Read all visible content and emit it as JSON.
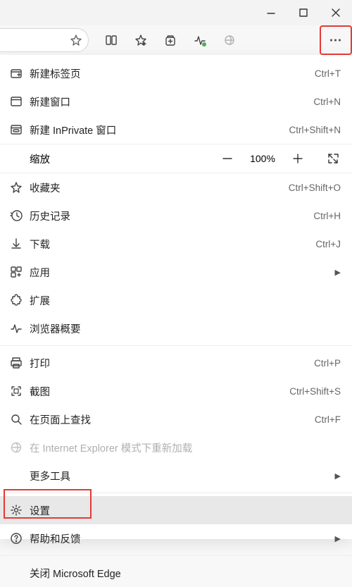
{
  "titlebar": {
    "minimize": "–",
    "maximize": "▢",
    "close": "✕"
  },
  "toolbar": {
    "star": "star-icon",
    "split": "split-icon",
    "favorites": "favorites-toolbar-icon",
    "collections": "collections-icon",
    "perf": "performance-icon",
    "ie": "ie-icon",
    "more": "⋯"
  },
  "menu": {
    "new_tab": {
      "label": "新建标签页",
      "shortcut": "Ctrl+T"
    },
    "new_window": {
      "label": "新建窗口",
      "shortcut": "Ctrl+N"
    },
    "new_inprivate": {
      "label": "新建 InPrivate 窗口",
      "shortcut": "Ctrl+Shift+N"
    },
    "zoom": {
      "label": "缩放",
      "value": "100%",
      "minus": "−",
      "plus": "+"
    },
    "favorites": {
      "label": "收藏夹",
      "shortcut": "Ctrl+Shift+O"
    },
    "history": {
      "label": "历史记录",
      "shortcut": "Ctrl+H"
    },
    "downloads": {
      "label": "下载",
      "shortcut": "Ctrl+J"
    },
    "apps": {
      "label": "应用"
    },
    "extensions": {
      "label": "扩展"
    },
    "browser_essentials": {
      "label": "浏览器概要"
    },
    "print": {
      "label": "打印",
      "shortcut": "Ctrl+P"
    },
    "screenshot": {
      "label": "截图",
      "shortcut": "Ctrl+Shift+S"
    },
    "find": {
      "label": "在页面上查找",
      "shortcut": "Ctrl+F"
    },
    "ie_reload": {
      "label": "在 Internet Explorer 模式下重新加载"
    },
    "more_tools": {
      "label": "更多工具"
    },
    "settings": {
      "label": "设置"
    },
    "help": {
      "label": "帮助和反馈"
    },
    "close_edge": {
      "label": "关闭 Microsoft Edge"
    }
  }
}
